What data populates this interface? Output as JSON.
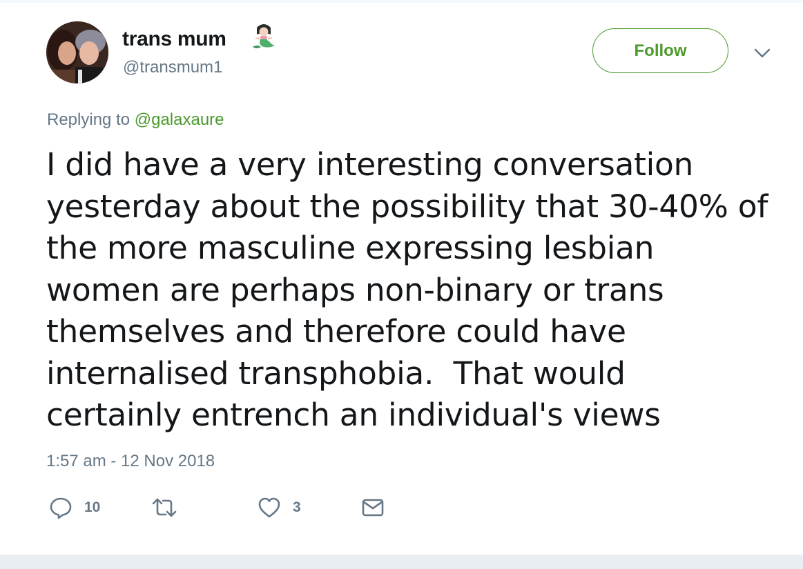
{
  "tweet": {
    "author": {
      "display_name": "trans mum",
      "name_emoji": "mermaid-emoji",
      "handle": "@transmum1"
    },
    "follow_label": "Follow",
    "menu_icon": "chevron-down-icon",
    "reply": {
      "prefix": "Replying to",
      "mention": "@galaxaure"
    },
    "text_lines": [
      "I did have a very interesting conversation",
      "yesterday about the possibility that 30-40% of",
      "the more masculine expressing lesbian",
      "women are perhaps non-binary or trans",
      "themselves and therefore could have",
      "internalised transphobia.  That would",
      "certainly entrench an individual's views"
    ],
    "timestamp": "1:57 am - 12 Nov 2018",
    "actions": {
      "reply": {
        "icon": "reply-icon",
        "count": "10"
      },
      "retweet": {
        "icon": "retweet-icon",
        "count": ""
      },
      "like": {
        "icon": "heart-icon",
        "count": "3"
      },
      "message": {
        "icon": "envelope-icon"
      }
    }
  },
  "colors": {
    "accent": "#4b9a2c",
    "secondary_text": "#657786",
    "primary_text": "#14171a"
  }
}
